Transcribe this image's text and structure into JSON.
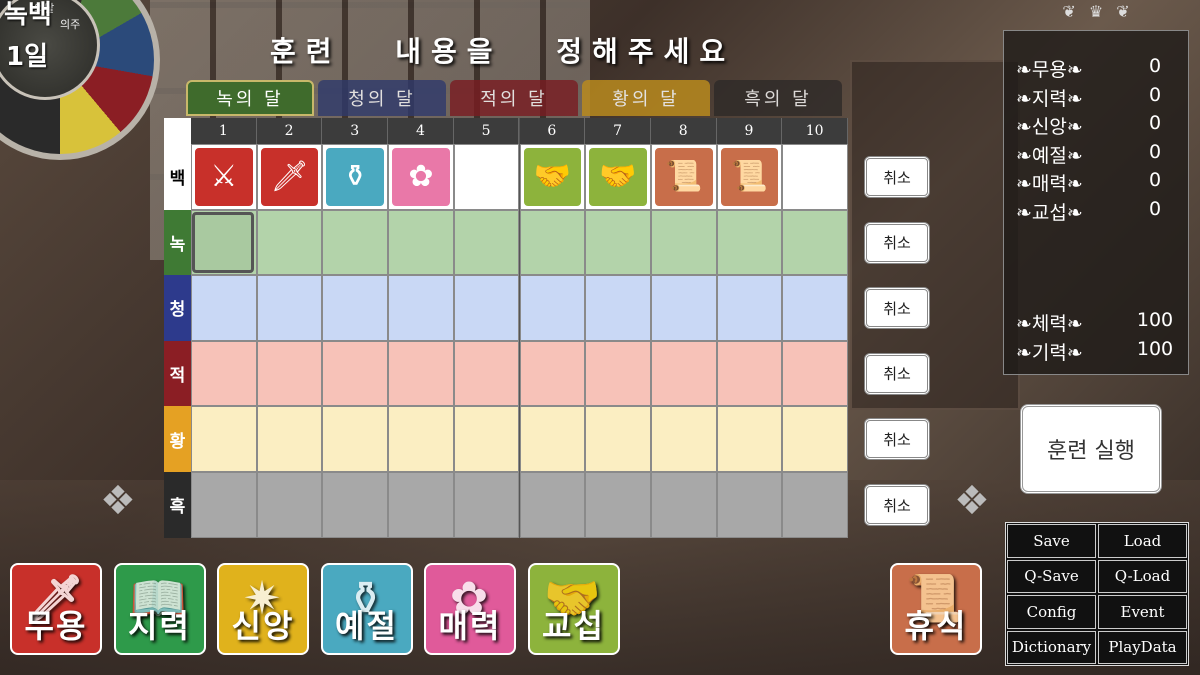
{
  "calendar": {
    "small_top": "의달",
    "main": "녹백",
    "small_side": "의주",
    "day": "1일"
  },
  "title": "훈련 내용을 정해주세요",
  "tabs": [
    "녹의 달",
    "청의 달",
    "적의 달",
    "황의 달",
    "흑의 달"
  ],
  "columns": [
    "1",
    "2",
    "3",
    "4",
    "5",
    "6",
    "7",
    "8",
    "9",
    "10"
  ],
  "rows": [
    {
      "label": "백",
      "color": "#ffffff",
      "text_color": "#000000",
      "cell_color": "#ffffff"
    },
    {
      "label": "녹",
      "color": "#3f7a34",
      "text_color": "#ffffff",
      "cell_color": "#b3d3aa"
    },
    {
      "label": "청",
      "color": "#2d3a8c",
      "text_color": "#ffffff",
      "cell_color": "#c9d8f5"
    },
    {
      "label": "적",
      "color": "#8b1e24",
      "text_color": "#ffffff",
      "cell_color": "#f7c2b8"
    },
    {
      "label": "황",
      "color": "#e5a123",
      "text_color": "#ffffff",
      "cell_color": "#fbeec2"
    },
    {
      "label": "흑",
      "color": "#2a2a2a",
      "text_color": "#ffffff",
      "cell_color": "#a8a8a8"
    }
  ],
  "schedule": [
    {
      "col": 1,
      "icon": "sword-crown-icon",
      "glyph": "⚔",
      "color": "#c8302a"
    },
    {
      "col": 2,
      "icon": "sword-icon",
      "glyph": "🗡",
      "color": "#c8302a"
    },
    {
      "col": 3,
      "icon": "pitcher-icon",
      "glyph": "⚱",
      "color": "#4aa9c0"
    },
    {
      "col": 4,
      "icon": "flower-icon",
      "glyph": "✿",
      "color": "#e978a8"
    },
    {
      "col": 6,
      "icon": "handshake-icon",
      "glyph": "🤝",
      "color": "#8db33c"
    },
    {
      "col": 7,
      "icon": "handshake-icon",
      "glyph": "🤝",
      "color": "#8db33c"
    },
    {
      "col": 8,
      "icon": "scroll-icon",
      "glyph": "📜",
      "color": "#c86e4a"
    },
    {
      "col": 9,
      "icon": "scroll-icon",
      "glyph": "📜",
      "color": "#c86e4a"
    }
  ],
  "cancel_label": "취소",
  "stats": {
    "attributes": [
      {
        "name": "무용",
        "value": "0"
      },
      {
        "name": "지력",
        "value": "0"
      },
      {
        "name": "신앙",
        "value": "0"
      },
      {
        "name": "예절",
        "value": "0"
      },
      {
        "name": "매력",
        "value": "0"
      },
      {
        "name": "교섭",
        "value": "0"
      }
    ],
    "vitals": [
      {
        "name": "체력",
        "value": "100"
      },
      {
        "name": "기력",
        "value": "100"
      }
    ]
  },
  "run_button": "훈련 실행",
  "system_menu": [
    "Save",
    "Load",
    "Q-Save",
    "Q-Load",
    "Config",
    "Event",
    "Dictionary",
    "PlayData"
  ],
  "training_buttons": [
    {
      "label": "무용",
      "icon": "sword-icon",
      "glyph": "🗡",
      "color": "#c8302a"
    },
    {
      "label": "지력",
      "icon": "book-icon",
      "glyph": "📖",
      "color": "#2e9a4a"
    },
    {
      "label": "신앙",
      "icon": "sun-icon",
      "glyph": "✷",
      "color": "#e0b21c"
    },
    {
      "label": "예절",
      "icon": "pitcher-icon",
      "glyph": "⚱",
      "color": "#4aa9c0"
    },
    {
      "label": "매력",
      "icon": "flower-icon",
      "glyph": "✿",
      "color": "#e05a9a"
    },
    {
      "label": "교섭",
      "icon": "handshake-icon",
      "glyph": "🤝",
      "color": "#8db33c"
    }
  ],
  "rest_button": {
    "label": "휴식",
    "icon": "scroll-icon",
    "glyph": "📜",
    "color": "#c86e4a"
  }
}
